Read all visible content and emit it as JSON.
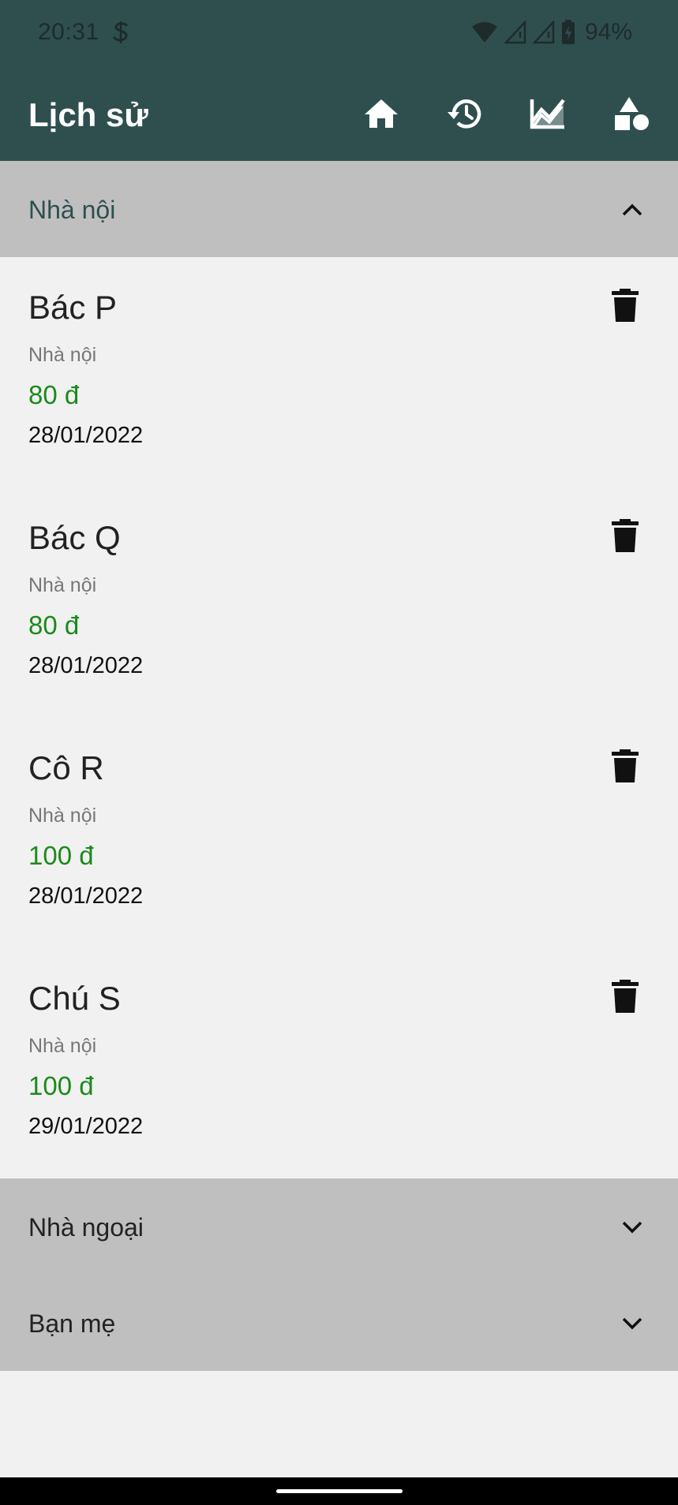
{
  "status": {
    "time": "20:31",
    "battery": "94%"
  },
  "app_bar": {
    "title": "Lịch sử",
    "actions": [
      "home-icon",
      "history-icon",
      "chart-icon",
      "category-icon"
    ]
  },
  "sections": [
    {
      "title": "Nhà nội",
      "expanded": true,
      "entries": [
        {
          "name": "Bác P",
          "group": "Nhà nội",
          "amount": "80 đ",
          "date": "28/01/2022"
        },
        {
          "name": "Bác Q",
          "group": "Nhà nội",
          "amount": "80 đ",
          "date": "28/01/2022"
        },
        {
          "name": "Cô R",
          "group": "Nhà nội",
          "amount": "100 đ",
          "date": "28/01/2022"
        },
        {
          "name": "Chú S",
          "group": "Nhà nội",
          "amount": "100 đ",
          "date": "29/01/2022"
        }
      ]
    },
    {
      "title": "Nhà ngoại",
      "expanded": false
    },
    {
      "title": "Bạn mẹ",
      "expanded": false
    }
  ],
  "colors": {
    "app_bar": "#2f4f4f",
    "section_header": "#bfbfbf",
    "expanded_title": "#2f4f4f",
    "amount": "#1a8a1a",
    "background": "#f1f1f1"
  }
}
